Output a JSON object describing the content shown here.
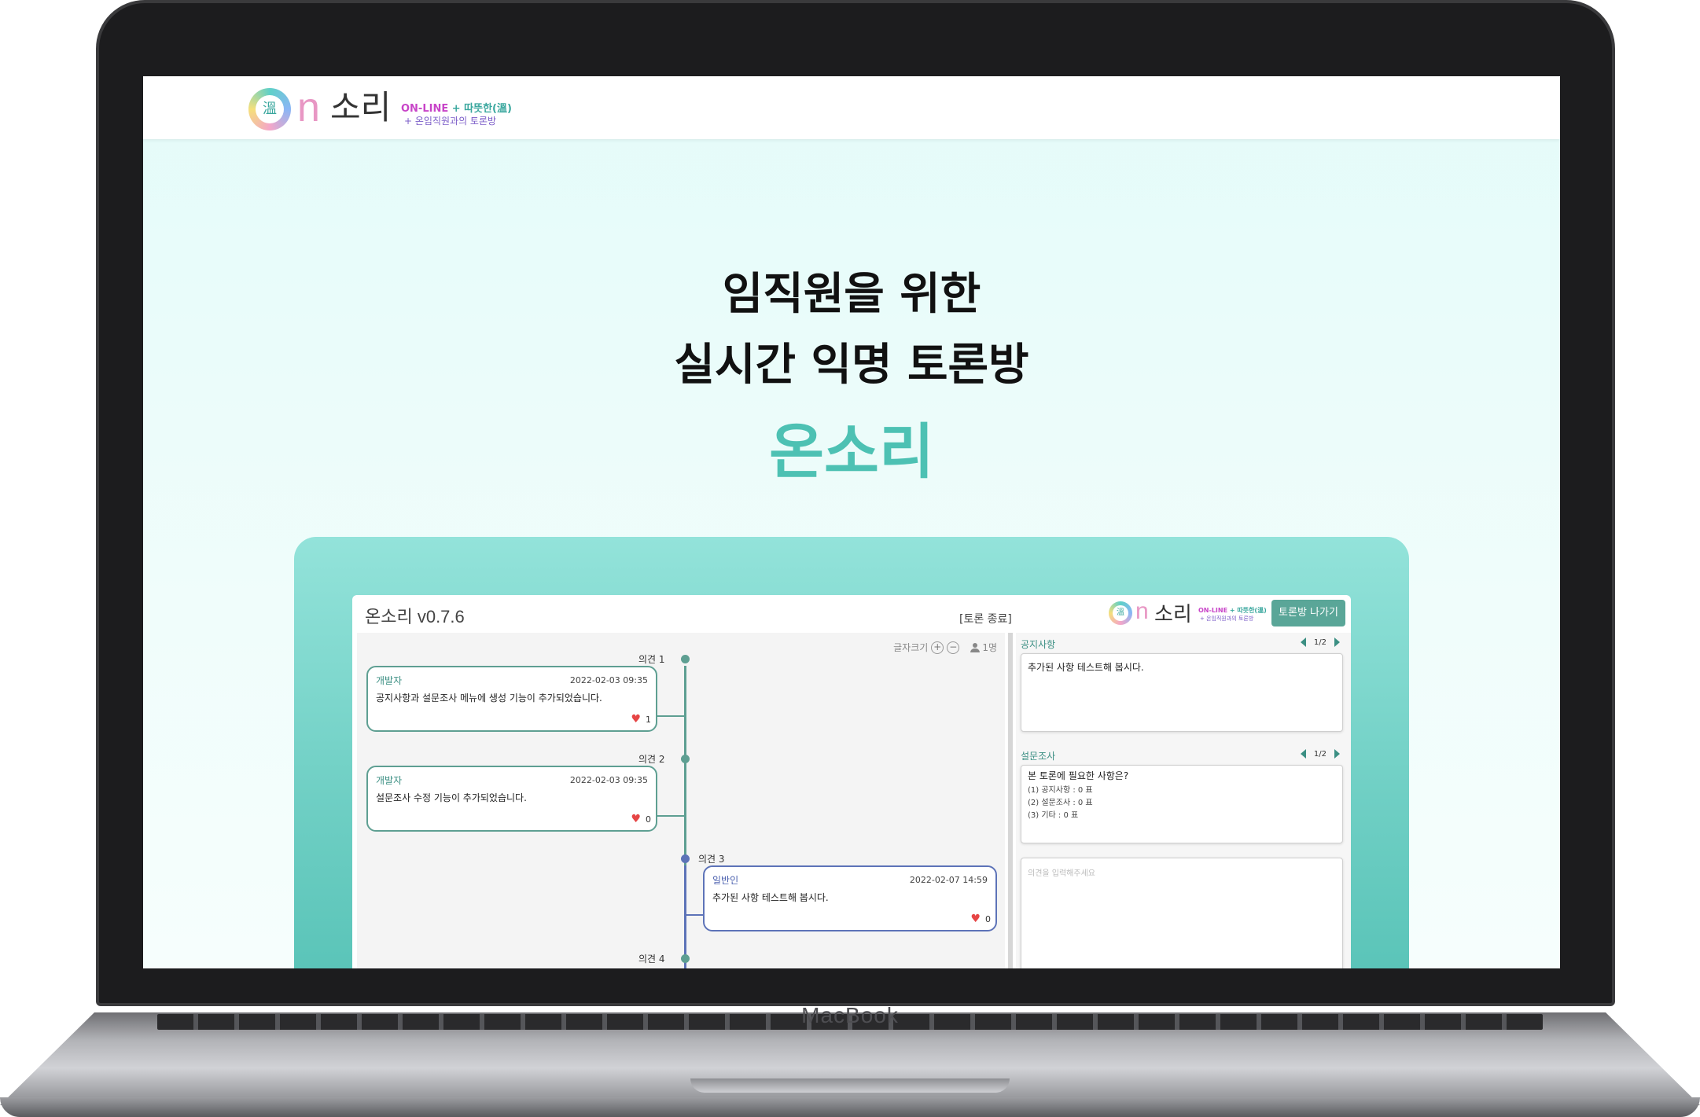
{
  "device": {
    "brand": "MacBook"
  },
  "site": {
    "logo": {
      "hanja": "溫",
      "n": "n",
      "text": "소리",
      "tag_online": "ON-LINE",
      "tag_plus": " + ",
      "tag_warm": "따뜻한(溫)",
      "tag_line2": "+ 온임직원과의 토론방"
    },
    "hero": {
      "line1": "임직원을 위한",
      "line2": "실시간 익명 토론방",
      "brand": "온소리"
    },
    "colors": {
      "accent": "#4dc1b3",
      "header_bg": "#ffffff",
      "page_bg": "#e4fbf9"
    }
  },
  "app": {
    "title": "온소리 v0.7.6",
    "status": "[토론 종료]",
    "exit_button": "토론방 나가기",
    "tools": {
      "font_size_label": "글자크기",
      "plus": "+",
      "minus": "−",
      "user_count": "1명"
    },
    "opinions": [
      {
        "label": "의견 1",
        "author": "개발자",
        "time": "2022-02-03 09:35",
        "body": "공지사항과 설문조사 메뉴에 생성 기능이 추가되었습니다.",
        "likes": "1"
      },
      {
        "label": "의견 2",
        "author": "개발자",
        "time": "2022-02-03 09:35",
        "body": "설문조사 수정 기능이 추가되었습니다.",
        "likes": "0"
      },
      {
        "label": "의견 3",
        "author": "일반인",
        "time": "2022-02-07 14:59",
        "body": "추가된 사항 테스트해 봅시다.",
        "likes": "0"
      },
      {
        "label": "의견 4"
      }
    ],
    "notice": {
      "title": "공지사항",
      "page": "1/2",
      "text": "추가된 사항 테스트해 봅시다."
    },
    "survey": {
      "title": "설문조사",
      "page": "1/2",
      "question": "본 토론에 필요한 사항은?",
      "options": [
        "(1) 공지사항 : 0 표",
        "(2) 설문조사 : 0 표",
        "(3) 기타 : 0 표"
      ]
    },
    "input": {
      "placeholder": "의견을 입력해주세요"
    }
  }
}
